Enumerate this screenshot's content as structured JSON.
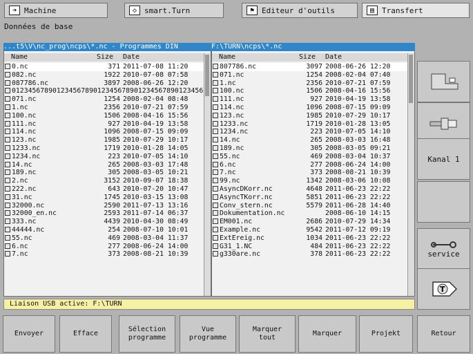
{
  "tabs": [
    {
      "label": "Machine",
      "icon": "arrow-right-icon"
    },
    {
      "label": "smart.Turn",
      "icon": "diamond-arrow-icon"
    },
    {
      "label": "Editeur d'outils",
      "icon": "flag-icon"
    },
    {
      "label": "Transfert",
      "icon": "save-icon"
    }
  ],
  "subtitle": "Données de base",
  "left": {
    "path": "...t5\\V\\nc_prog\\ncps\\*.nc - Programmes DIN",
    "headers": {
      "name": "Name",
      "size": "Size",
      "date": "Date"
    },
    "rows": [
      {
        "name": "0.nc",
        "size": "371",
        "date": "2011-07-08 11:20"
      },
      {
        "name": "082.nc",
        "size": "1922",
        "date": "2010-07-08 07:58"
      },
      {
        "name": "087786.nc",
        "size": "3897",
        "date": "2008-06-26 12:20"
      },
      {
        "name": "0123456789012345678901234567890123456789012345678...",
        "size": "",
        "date": ""
      },
      {
        "name": "071.nc",
        "size": "1254",
        "date": "2008-02-04 08:48"
      },
      {
        "name": "1.nc",
        "size": "2356",
        "date": "2010-07-21 07:59"
      },
      {
        "name": "100.nc",
        "size": "1506",
        "date": "2008-04-16 15:56"
      },
      {
        "name": "111.nc",
        "size": "927",
        "date": "2010-04-19 13:58"
      },
      {
        "name": "114.nc",
        "size": "1096",
        "date": "2008-07-15 09:09"
      },
      {
        "name": "123.nc",
        "size": "1985",
        "date": "2010-07-29 10:17"
      },
      {
        "name": "1233.nc",
        "size": "1719",
        "date": "2010-01-28 14:05"
      },
      {
        "name": "1234.nc",
        "size": "223",
        "date": "2010-07-05 14:10"
      },
      {
        "name": "14.nc",
        "size": "265",
        "date": "2008-03-03 17:48"
      },
      {
        "name": "189.nc",
        "size": "305",
        "date": "2008-03-05 10:21"
      },
      {
        "name": "2.nc",
        "size": "3152",
        "date": "2010-09-07 18:38"
      },
      {
        "name": "222.nc",
        "size": "643",
        "date": "2010-07-20 10:47"
      },
      {
        "name": "31.nc",
        "size": "1745",
        "date": "2010-03-15 13:08"
      },
      {
        "name": "32000.nc",
        "size": "2590",
        "date": "2011-07-13 13:16"
      },
      {
        "name": "32000_en.nc",
        "size": "2593",
        "date": "2011-07-14 06:37"
      },
      {
        "name": "333.nc",
        "size": "4439",
        "date": "2010-04-30 08:49"
      },
      {
        "name": "44444.nc",
        "size": "254",
        "date": "2008-07-10 10:01"
      },
      {
        "name": "55.nc",
        "size": "469",
        "date": "2008-03-04 11:37"
      },
      {
        "name": "6.nc",
        "size": "277",
        "date": "2008-06-24 14:00"
      },
      {
        "name": "7.nc",
        "size": "373",
        "date": "2008-08-21 10:39"
      }
    ]
  },
  "right": {
    "path": "F:\\TURN\\ncps\\*.nc",
    "headers": {
      "name": "Name",
      "size": "Size",
      "date": "Date"
    },
    "rows": [
      {
        "name": "807786.nc",
        "size": "3097",
        "date": "2008-06-26 12:20"
      },
      {
        "name": "071.nc",
        "size": "1254",
        "date": "2008-02-04 07:40"
      },
      {
        "name": "1.nc",
        "size": "2356",
        "date": "2010-07-21 07:59"
      },
      {
        "name": "100.nc",
        "size": "1506",
        "date": "2008-04-16 15:56"
      },
      {
        "name": "111.nc",
        "size": "927",
        "date": "2010-04-19 13:58"
      },
      {
        "name": "114.nc",
        "size": "1096",
        "date": "2008-07-15 09:09"
      },
      {
        "name": "123.nc",
        "size": "1985",
        "date": "2010-07-29 10:17"
      },
      {
        "name": "1233.nc",
        "size": "1719",
        "date": "2010-01-28 13:05"
      },
      {
        "name": "1234.nc",
        "size": "223",
        "date": "2010-07-05 14:10"
      },
      {
        "name": "14.nc",
        "size": "265",
        "date": "2008-03-03 16:48"
      },
      {
        "name": "189.nc",
        "size": "305",
        "date": "2008-03-05 09:21"
      },
      {
        "name": "55.nc",
        "size": "469",
        "date": "2008-03-04 10:37"
      },
      {
        "name": "6.nc",
        "size": "277",
        "date": "2008-06-24 14:00"
      },
      {
        "name": "7.nc",
        "size": "373",
        "date": "2008-08-21 10:39"
      },
      {
        "name": "99.nc",
        "size": "1342",
        "date": "2008-03-06 10:08"
      },
      {
        "name": "AsyncDKorr.nc",
        "size": "4648",
        "date": "2011-06-23 22:22"
      },
      {
        "name": "AsyncTKorr.nc",
        "size": "5851",
        "date": "2011-06-23 22:22"
      },
      {
        "name": "Conv_stern.nc",
        "size": "5579",
        "date": "2011-06-28 14:40"
      },
      {
        "name": "Dokumentation.nc",
        "size": "",
        "date": "2008-06-10 14:15"
      },
      {
        "name": "EM001.nc",
        "size": "2686",
        "date": "2010-07-29 14:34"
      },
      {
        "name": "Example.nc",
        "size": "9542",
        "date": "2011-07-12 09:19"
      },
      {
        "name": "ExtEreig.nc",
        "size": "1034",
        "date": "2011-06-23 22:22"
      },
      {
        "name": "G31_1.NC",
        "size": "484",
        "date": "2011-06-23 22:22"
      },
      {
        "name": "g330are.nc",
        "size": "378",
        "date": "2011-06-23 22:22"
      }
    ]
  },
  "status": "Liaison USB active: F:\\TURN",
  "side_keys": [
    {
      "type": "icon",
      "icon": "lathe-tool-icon"
    },
    {
      "type": "icon",
      "icon": "tool-holder-icon"
    },
    {
      "type": "label",
      "label": "Kanal 1"
    },
    {
      "type": "blank"
    },
    {
      "type": "icon-label",
      "icon": "wrench-icon",
      "label": "service"
    },
    {
      "type": "icon",
      "icon": "t-arrow-icon"
    }
  ],
  "bottom_keys": [
    {
      "label": "Envoyer"
    },
    {
      "label": "Efface"
    },
    {
      "label": "Sélection\nprogramme"
    },
    {
      "label": "Vue\nprogramme"
    },
    {
      "label": "Marquer\ntout"
    },
    {
      "label": "Marquer"
    },
    {
      "label": "Projekt"
    },
    {
      "label": "Retour"
    }
  ]
}
